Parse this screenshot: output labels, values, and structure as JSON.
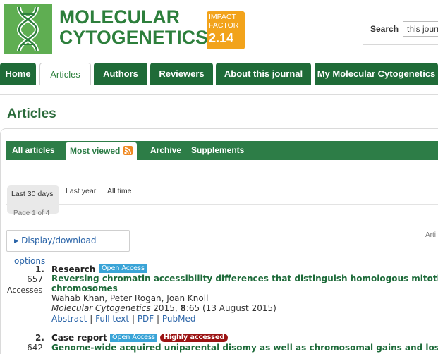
{
  "header": {
    "logo_line1": "MOLECULAR",
    "logo_line2": "CYTOGENETICS",
    "impact_line1": "IMPACT",
    "impact_line2": "FACTOR",
    "impact_value": "2.14",
    "search_label": "Search",
    "search_value": "this journ"
  },
  "colors": {
    "brand_green": "#2d7f3c",
    "nav_green": "#1f6b38",
    "impact_orange": "#f2a31b",
    "link_blue": "#2a64a8",
    "open_access": "#3aa4d7",
    "highly_accessed": "#9c1414"
  },
  "nav": {
    "tabs": [
      {
        "label": "Home"
      },
      {
        "label": "Articles",
        "active": true
      },
      {
        "label": "Authors"
      },
      {
        "label": "Reviewers"
      },
      {
        "label": "About this journal"
      },
      {
        "label": "My Molecular Cytogenetics"
      }
    ]
  },
  "page_title": "Articles",
  "subnav": {
    "items": [
      {
        "label": "All articles"
      },
      {
        "label": "Most viewed",
        "active": true,
        "icon": "rss-icon"
      },
      {
        "label": "Archive"
      },
      {
        "label": "Supplements"
      }
    ]
  },
  "periods": [
    {
      "label": "Last 30 days",
      "active": true
    },
    {
      "label": "Last year"
    },
    {
      "label": "All time"
    }
  ],
  "pager_text": "Page 1 of 4",
  "display_options": "Display/download options",
  "right_cut_text": "Arti",
  "articles": [
    {
      "rank": "1.",
      "accesses": "657",
      "accesses_label": "Accesses",
      "type": "Research",
      "badges": [
        "Open Access"
      ],
      "title_line1": "Reversing chromatin accessibility differences that distinguish homologous mitotic meta",
      "title_line2": "chromosomes",
      "authors": "Wahab Khan, Peter Rogan, Joan Knoll",
      "journal": "Molecular Cytogenetics",
      "year": "2015",
      "volume": "8",
      "article_no": "65",
      "date": "(13 August 2015)",
      "links": [
        "Abstract",
        "Full text",
        "PDF",
        "PubMed"
      ]
    },
    {
      "rank": "2.",
      "accesses": "642",
      "type": "Case report",
      "badges": [
        "Open Access",
        "Highly accessed"
      ],
      "title_line1": "Genome-wide acquired uniparental disomy as well as chromosomal gains and losses in"
    }
  ]
}
